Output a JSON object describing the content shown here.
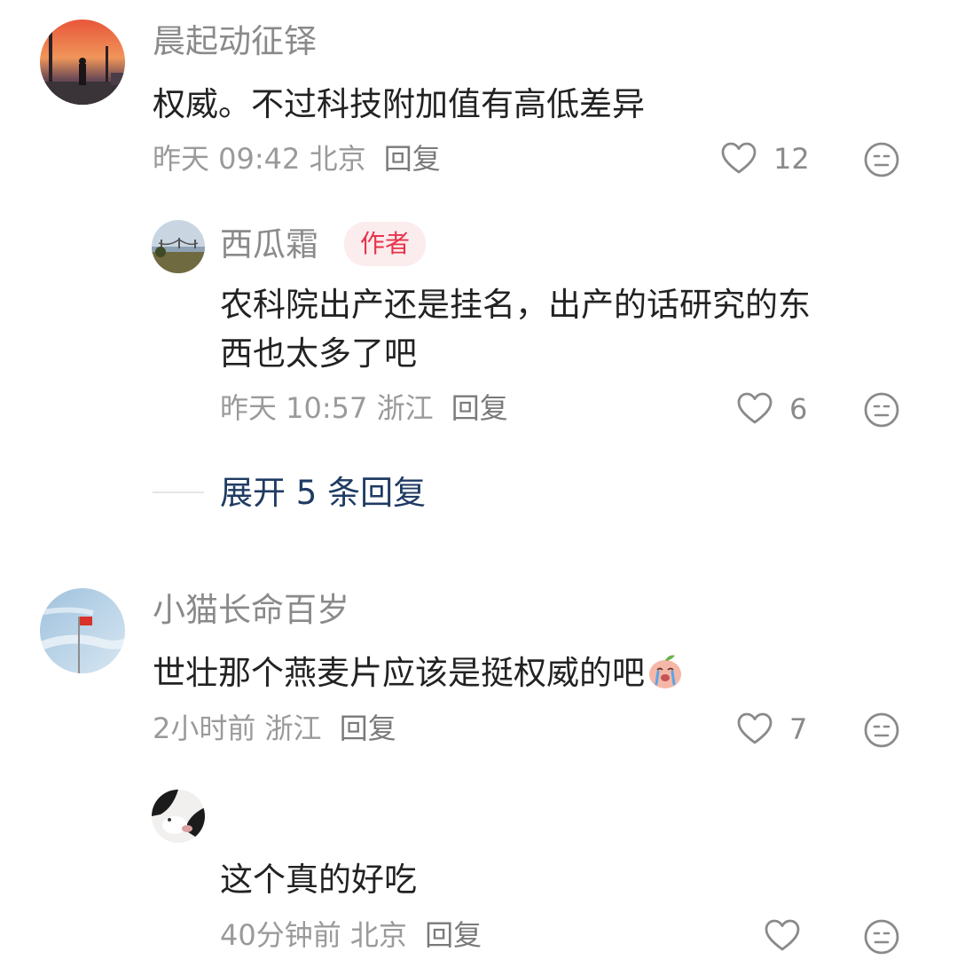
{
  "comments": [
    {
      "username": "晨起动征铎",
      "text": "权威。不过科技附加值有高低差异",
      "time": "昨天 09:42",
      "location": "北京",
      "reply_label": "回复",
      "likes": "12",
      "avatar_icon": "sunset-street-avatar",
      "replies": [
        {
          "username": "西瓜霜",
          "badge": "作者",
          "text_line1": "农科院出产还是挂名，出产的话研究的东",
          "text_line2": "西也太多了吧",
          "time": "昨天 10:57",
          "location": "浙江",
          "reply_label": "回复",
          "likes": "6",
          "avatar_icon": "bridge-landscape-avatar"
        }
      ],
      "expand_label": "展开 5 条回复"
    },
    {
      "username": "小猫长命百岁",
      "text": "世壮那个燕麦片应该是挺权威的吧",
      "time": "2小时前",
      "location": "浙江",
      "reply_label": "回复",
      "likes": "7",
      "avatar_icon": "flag-sky-avatar",
      "inline_emoji": "crying-peach-emoji",
      "replies": [
        {
          "username": "",
          "text": "这个真的好吃",
          "time": "40分钟前",
          "location": "北京",
          "reply_label": "回复",
          "likes": "",
          "avatar_icon": "cat-avatar"
        }
      ]
    }
  ],
  "colors": {
    "author_badge_bg": "#fbecee",
    "author_badge_text": "#e8334a",
    "expand_link": "#1f3b63",
    "meta_gray": "#9a9a9a"
  }
}
